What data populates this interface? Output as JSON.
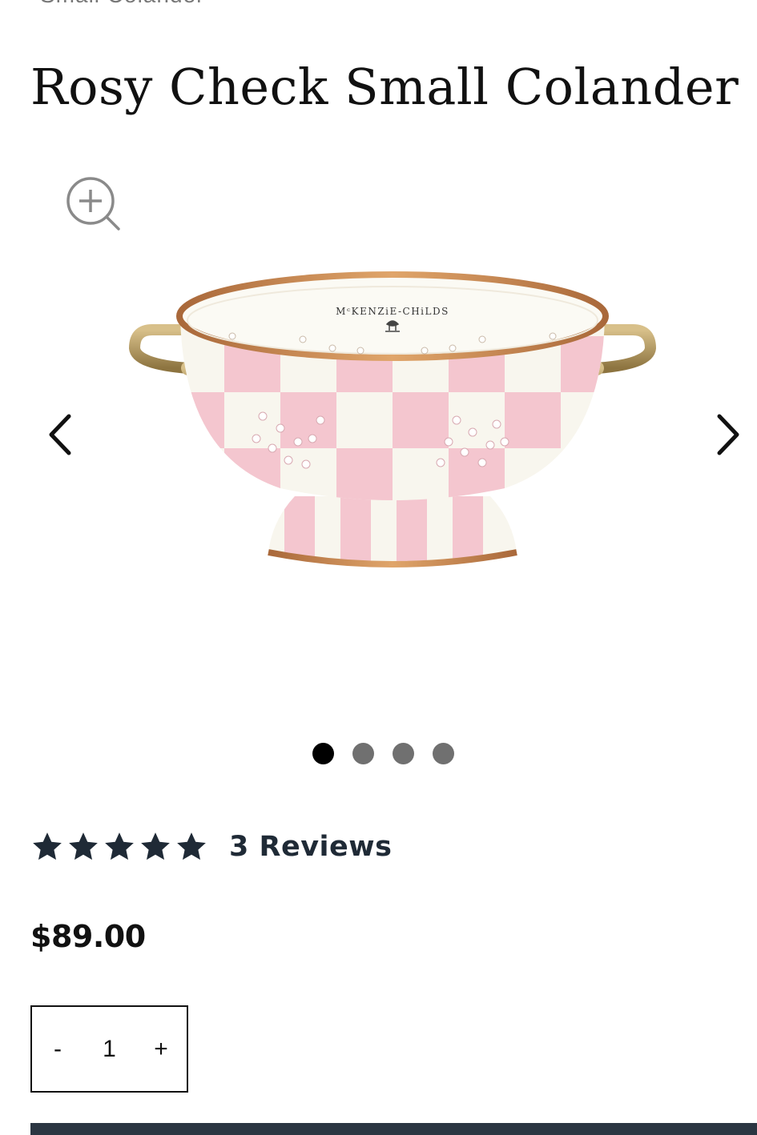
{
  "breadcrumb": {
    "text": "Small Colander"
  },
  "product": {
    "title": "Rosy Check Small Colander",
    "brand_mark": "MᶜKENZiE-CHiLDS",
    "price": "$89.00"
  },
  "gallery": {
    "total_images": 4,
    "active_index": 0
  },
  "rating": {
    "stars": 5,
    "max_stars": 5,
    "reviews_label": "3 Reviews"
  },
  "quantity": {
    "minus_label": "-",
    "value": "1",
    "plus_label": "+"
  },
  "colors": {
    "text": "#111111",
    "star": "#1f2a36",
    "button_bar": "#2b3642",
    "dot_active": "#000000",
    "dot_inactive": "#707070",
    "colander_pink": "#f4c6cf",
    "colander_cream": "#f8f6ee",
    "copper_trim": "#c98a4e",
    "handle_brass": "#b89a5a"
  },
  "icons": {
    "zoom": "zoom-in-icon",
    "prev": "chevron-left-icon",
    "next": "chevron-right-icon",
    "star": "star-icon"
  }
}
